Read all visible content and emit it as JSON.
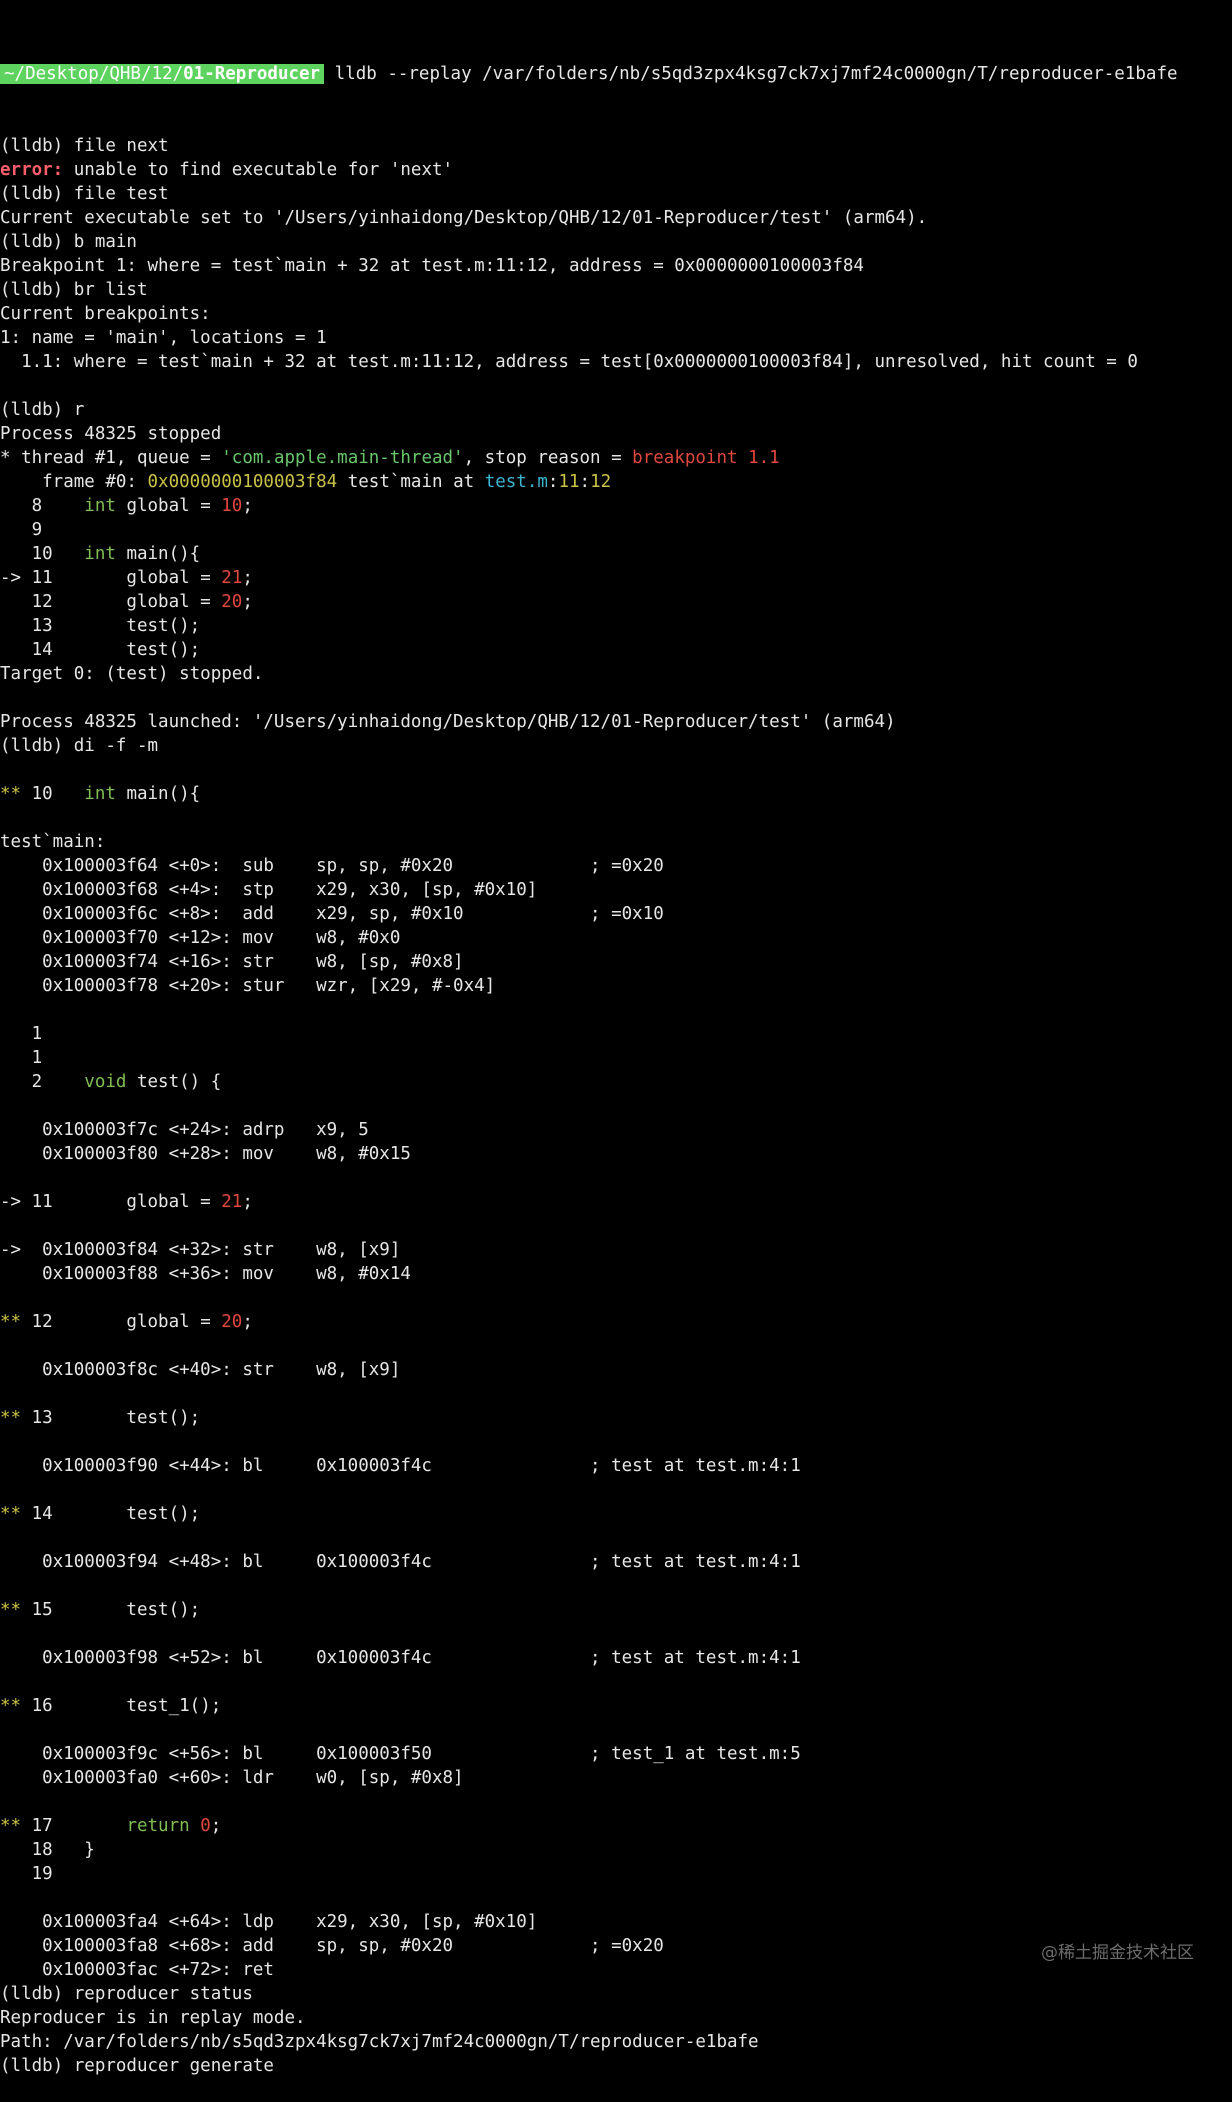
{
  "terminal": {
    "prompt_path_prefix": "~/Desktop/QHB/12/",
    "prompt_path_bold": "01-Reproducer",
    "command": "lldb --replay /var/folders/nb/s5qd3zpx4ksg7ck7xj7mf24c0000gn/T/reproducer-e1bafe",
    "lines": [
      [
        {
          "t": "(lldb) file next"
        }
      ],
      [
        {
          "t": "error:",
          "c": "error"
        },
        {
          "t": " unable to find executable for 'next'"
        }
      ],
      [
        {
          "t": "(lldb) file test"
        }
      ],
      [
        {
          "t": "Current executable set to '/Users/yinhaidong/Desktop/QHB/12/01-Reproducer/test' (arm64)."
        }
      ],
      [
        {
          "t": "(lldb) b main"
        }
      ],
      [
        {
          "t": "Breakpoint 1: where = test`main + 32 at test.m:11:12, address = 0x0000000100003f84"
        }
      ],
      [
        {
          "t": "(lldb) br list"
        }
      ],
      [
        {
          "t": "Current breakpoints:"
        }
      ],
      [
        {
          "t": "1: name = 'main', locations = 1"
        }
      ],
      [
        {
          "t": "  1.1: where = test`main + 32 at test.m:11:12, address = test[0x0000000100003f84], unresolved, hit count = 0"
        }
      ],
      [
        {
          "t": ""
        }
      ],
      [
        {
          "t": "(lldb) r"
        }
      ],
      [
        {
          "t": "Process 48325 stopped"
        }
      ],
      [
        {
          "t": "* thread #1, queue = "
        },
        {
          "t": "'com.apple.main-thread'",
          "c": "str"
        },
        {
          "t": ", stop reason = "
        },
        {
          "t": "breakpoint 1.1",
          "c": "red"
        }
      ],
      [
        {
          "t": "    frame #0: "
        },
        {
          "t": "0x0000000100003f84",
          "c": "addr"
        },
        {
          "t": " test`main at "
        },
        {
          "t": "test.m",
          "c": "file"
        },
        {
          "t": ":"
        },
        {
          "t": "11",
          "c": "addr"
        },
        {
          "t": ":"
        },
        {
          "t": "12",
          "c": "addr"
        }
      ],
      [
        {
          "t": "   8    "
        },
        {
          "t": "int",
          "c": "kw"
        },
        {
          "t": " global = "
        },
        {
          "t": "10",
          "c": "num"
        },
        {
          "t": ";"
        }
      ],
      [
        {
          "t": "   9"
        }
      ],
      [
        {
          "t": "   10   "
        },
        {
          "t": "int",
          "c": "kw"
        },
        {
          "t": " main(){"
        }
      ],
      [
        {
          "t": "-> 11       global "
        },
        {
          "t": "=",
          "c": "u"
        },
        {
          "t": " "
        },
        {
          "t": "21",
          "c": "num"
        },
        {
          "t": ";"
        }
      ],
      [
        {
          "t": "   12       global = "
        },
        {
          "t": "20",
          "c": "num"
        },
        {
          "t": ";"
        }
      ],
      [
        {
          "t": "   13       test();"
        }
      ],
      [
        {
          "t": "   14       test();"
        }
      ],
      [
        {
          "t": "Target 0: (test) stopped."
        }
      ],
      [
        {
          "t": ""
        }
      ],
      [
        {
          "t": "Process 48325 launched: '/Users/yinhaidong/Desktop/QHB/12/01-Reproducer/test' (arm64)"
        }
      ],
      [
        {
          "t": "(lldb) di -f -m"
        }
      ],
      [
        {
          "t": ""
        }
      ],
      [
        {
          "t": "**",
          "c": "star"
        },
        {
          "t": " 10   "
        },
        {
          "t": "int",
          "c": "kw"
        },
        {
          "t": " main(){"
        }
      ],
      [
        {
          "t": ""
        }
      ],
      [
        {
          "t": "test`main:"
        }
      ],
      [
        {
          "t": "    0x100003f64 <+0>:  sub    sp, sp, #0x20             ; =0x20"
        }
      ],
      [
        {
          "t": "    0x100003f68 <+4>:  stp    x29, x30, [sp, #0x10]"
        }
      ],
      [
        {
          "t": "    0x100003f6c <+8>:  add    x29, sp, #0x10            ; =0x10"
        }
      ],
      [
        {
          "t": "    0x100003f70 <+12>: mov    w8, #0x0"
        }
      ],
      [
        {
          "t": "    0x100003f74 <+16>: str    w8, [sp, #0x8]"
        }
      ],
      [
        {
          "t": "    0x100003f78 <+20>: stur   wzr, [x29, #-0x4]"
        }
      ],
      [
        {
          "t": ""
        }
      ],
      [
        {
          "t": "   1"
        }
      ],
      [
        {
          "t": "   1"
        }
      ],
      [
        {
          "t": "   2    "
        },
        {
          "t": "void",
          "c": "kw"
        },
        {
          "t": " test() {"
        }
      ],
      [
        {
          "t": ""
        }
      ],
      [
        {
          "t": "    0x100003f7c <+24>: adrp   x9, 5"
        }
      ],
      [
        {
          "t": "    0x100003f80 <+28>: mov    w8, #0x15"
        }
      ],
      [
        {
          "t": ""
        }
      ],
      [
        {
          "t": "-> 11       global = "
        },
        {
          "t": "21",
          "c": "num"
        },
        {
          "t": ";"
        }
      ],
      [
        {
          "t": ""
        }
      ],
      [
        {
          "t": "->  0x100003f84 <+32>: str    w8, [x9]"
        }
      ],
      [
        {
          "t": "    0x100003f88 <+36>: mov    w8, #0x14"
        }
      ],
      [
        {
          "t": ""
        }
      ],
      [
        {
          "t": "**",
          "c": "star"
        },
        {
          "t": " 12       global = "
        },
        {
          "t": "20",
          "c": "num"
        },
        {
          "t": ";"
        }
      ],
      [
        {
          "t": ""
        }
      ],
      [
        {
          "t": "    0x100003f8c <+40>: str    w8, [x9]"
        }
      ],
      [
        {
          "t": ""
        }
      ],
      [
        {
          "t": "**",
          "c": "star"
        },
        {
          "t": " 13       test();"
        }
      ],
      [
        {
          "t": ""
        }
      ],
      [
        {
          "t": "    0x100003f90 <+44>: bl     0x100003f4c               ; test at test.m:4:1"
        }
      ],
      [
        {
          "t": ""
        }
      ],
      [
        {
          "t": "**",
          "c": "star"
        },
        {
          "t": " 14       test();"
        }
      ],
      [
        {
          "t": ""
        }
      ],
      [
        {
          "t": "    0x100003f94 <+48>: bl     0x100003f4c               ; test at test.m:4:1"
        }
      ],
      [
        {
          "t": ""
        }
      ],
      [
        {
          "t": "**",
          "c": "star"
        },
        {
          "t": " 15       test();"
        }
      ],
      [
        {
          "t": ""
        }
      ],
      [
        {
          "t": "    0x100003f98 <+52>: bl     0x100003f4c               ; test at test.m:4:1"
        }
      ],
      [
        {
          "t": ""
        }
      ],
      [
        {
          "t": "**",
          "c": "star"
        },
        {
          "t": " 16       test_1();"
        }
      ],
      [
        {
          "t": ""
        }
      ],
      [
        {
          "t": "    0x100003f9c <+56>: bl     0x100003f50               ; test_1 at test.m:5"
        }
      ],
      [
        {
          "t": "    0x100003fa0 <+60>: ldr    w0, [sp, #0x8]"
        }
      ],
      [
        {
          "t": ""
        }
      ],
      [
        {
          "t": "**",
          "c": "star"
        },
        {
          "t": " 17       "
        },
        {
          "t": "return",
          "c": "kw"
        },
        {
          "t": " "
        },
        {
          "t": "0",
          "c": "num"
        },
        {
          "t": ";"
        }
      ],
      [
        {
          "t": "   18   }"
        }
      ],
      [
        {
          "t": "   19"
        }
      ],
      [
        {
          "t": ""
        }
      ],
      [
        {
          "t": "    0x100003fa4 <+64>: ldp    x29, x30, [sp, #0x10]"
        }
      ],
      [
        {
          "t": "    0x100003fa8 <+68>: add    sp, sp, #0x20             ; =0x20"
        }
      ],
      [
        {
          "t": "    0x100003fac <+72>: ret"
        }
      ],
      [
        {
          "t": "(lldb) reproducer status"
        }
      ],
      [
        {
          "t": "Reproducer is in replay mode."
        }
      ],
      [
        {
          "t": "Path: /var/folders/nb/s5qd3zpx4ksg7ck7xj7mf24c0000gn/T/reproducer-e1bafe"
        }
      ],
      [
        {
          "t": "(lldb) reproducer generate"
        }
      ]
    ]
  },
  "watermark": "@稀土掘金技术社区",
  "colors": {
    "background": "#000000",
    "text": "#e6e6e6",
    "prompt_bg": "#5fd35f",
    "error": "#ff5f6a",
    "number": "#e0473f",
    "keyword": "#7fbf52",
    "string": "#69c66b",
    "address": "#c9c246",
    "file": "#3ab5d0"
  }
}
